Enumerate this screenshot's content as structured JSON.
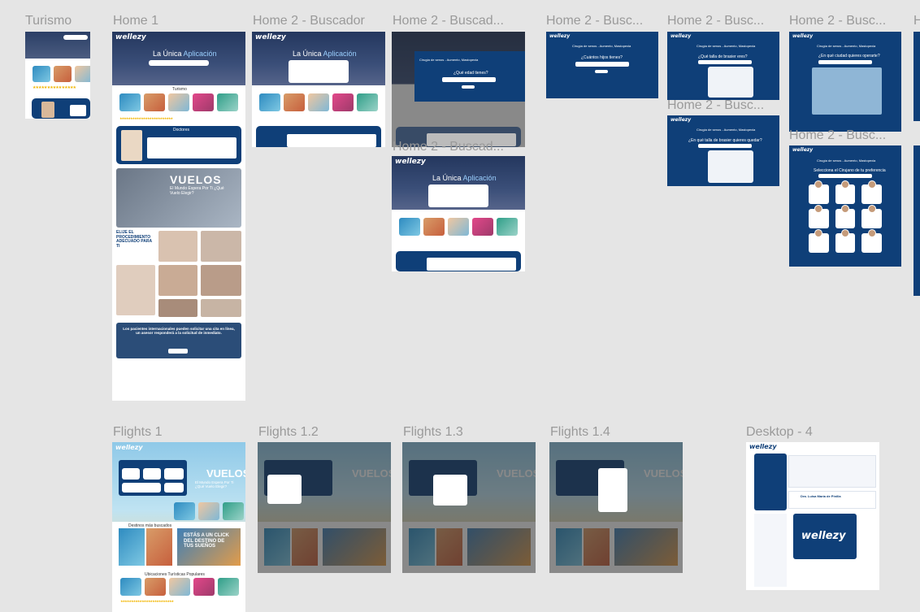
{
  "frames": {
    "turismo": "Turismo",
    "home1": "Home 1",
    "home2_buscador": "Home 2 - Buscador",
    "home2_buscad_trunc": "Home 2 - Buscad...",
    "home2_busc_1": "Home 2 - Busc...",
    "home2_busc_2": "Home 2 - Busc...",
    "home2_busc_3": "Home 2 - Busc...",
    "home2_busc_4": "Home 2 - Busc...",
    "home2_busc_5": "Home 2 - Busc...",
    "home2_buscad_lower": "Home 2 - Buscad...",
    "h_cut": "H",
    "flights1": "Flights 1",
    "flights12": "Flights 1.2",
    "flights13": "Flights 1.3",
    "flights14": "Flights 1.4",
    "desktop4": "Desktop - 4"
  },
  "brand": {
    "logo": "wellezy",
    "primary": "#0f3f78",
    "accent": "#2e8bc0",
    "star": "#f2b705"
  },
  "home": {
    "hero_title": "La Única",
    "hero_accent": "Aplicación",
    "turismo_label": "Turismo",
    "doctores_label": "Doctores",
    "vuelos_title": "VUELOS",
    "vuelos_sub": "El Mundo Espera Por Ti ¿Qué Vuelo Elegir?",
    "procedimiento_title": "ELIJE EL PROCEDIMIENTO ADECUADO PARA TI",
    "internacional_text": "Los pacientes internacionales pueden solicitar una cita en línea, un asesor responderá a la solicitud de inmediato.",
    "ver_mas": "VER MÁS"
  },
  "modals": {
    "edad_question": "¿Qué edad tienes?",
    "hijos_question": "¿Cuántos hijos tienes?",
    "talla_question": "¿Qué talla de brasier eres?",
    "talla_question2": "¿En qué talla de brasier quieres quedar?",
    "ciudad_question": "¿En qué ciudad quieres operarte?",
    "cirujano_question": "Selecciona el Cirujano de tu preferencia",
    "subtitle": "Cirugía de senos - Aumento, Mastopexia"
  },
  "flights": {
    "vuelos": "VUELOS",
    "vuelos_sub": "El Mundo Espera Por Ti ¿Qué Vuelo Elegir?",
    "origen": "ORIGEN",
    "destino": "DESTINO",
    "pasajeros": "PASAJEROS",
    "destinos_buscados": "Destinos más buscados",
    "click_title": "ESTÁS A UN CLICK DEL DESTINO DE TUS SUEÑOS",
    "cartagena": "CARTAGENA",
    "capadocia": "CAPADOCIA",
    "clase": "CLASE",
    "ubicaciones": "Ubicaciones Turísticas Populares"
  },
  "desktop": {
    "logo": "wellezy",
    "doctor_name": "Dra. Luisa María de Pinilla"
  }
}
